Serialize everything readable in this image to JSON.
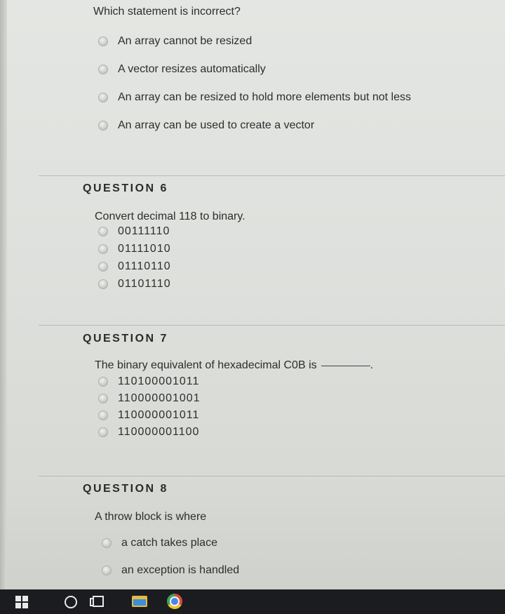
{
  "questions": [
    {
      "prompt": "Which statement is incorrect?",
      "options": [
        "An array cannot be resized",
        "A vector resizes automatically",
        "An array can be resized to hold more elements but not less",
        "An array can be used to create a vector"
      ]
    },
    {
      "header": "QUESTION 6",
      "prompt": "Convert decimal 118 to binary.",
      "options": [
        "00111110",
        "01111010",
        "01110110",
        "01101110"
      ]
    },
    {
      "header": "QUESTION 7",
      "prompt": "The binary equivalent of hexadecimal C0B is",
      "blank_suffix": ".",
      "options": [
        "110100001011",
        "110000001001",
        "110000001011",
        "110000001100"
      ]
    },
    {
      "header": "QUESTION 8",
      "prompt": "A throw block is where",
      "options": [
        "a catch takes place",
        "an exception is handled"
      ]
    }
  ],
  "taskbar": {
    "icons": [
      "windows-start-icon",
      "search-icon",
      "task-view-icon",
      "file-explorer-icon",
      "chrome-icon"
    ]
  }
}
